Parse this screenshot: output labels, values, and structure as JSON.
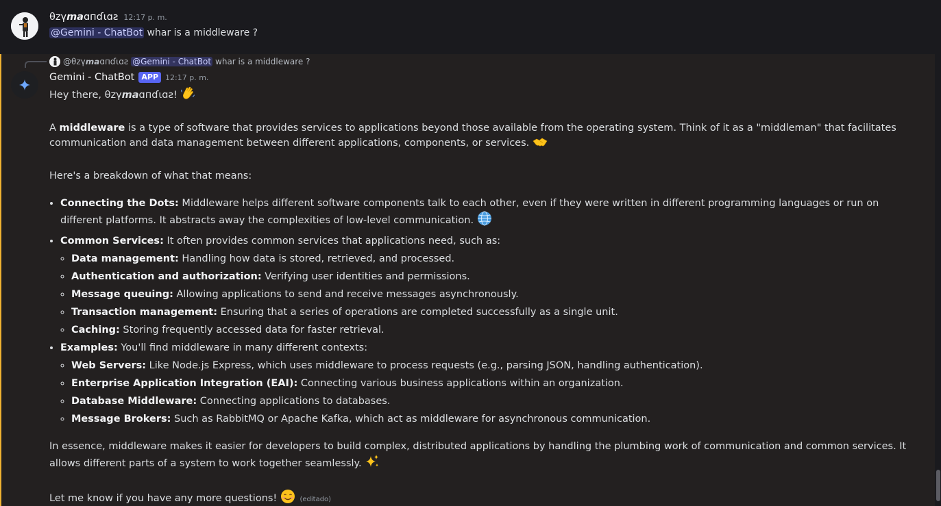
{
  "message1": {
    "username": "θzγ𝙢𝙖ɑпɗɩɑƨ",
    "timestamp": "12:17 p. m.",
    "mention": "@Gemini - ChatBot",
    "text": "whar is a middleware ?"
  },
  "reply": {
    "username": "@θzγ𝙢𝙖ɑпɗɩɑƨ",
    "mention": "@Gemini - ChatBot",
    "text": "whar is a middleware ?"
  },
  "message2": {
    "bot_name": "Gemini - ChatBot",
    "badge": "APP",
    "timestamp": "12:17 p. m.",
    "greeting": "Hey there, θzγ𝙢𝙖ɑпɗɩɑƨ!",
    "intro_a": "A ",
    "intro_bold": "middleware",
    "intro_rest": " is a type of software that provides services to applications beyond those available from the operating system. Think of it as a \"middleman\" that facilitates communication and data management between different applications, components, or services.",
    "breakdown": "Here's a breakdown of what that means:",
    "bullets": [
      {
        "title": "Connecting the Dots:",
        "text": " Middleware helps different software components talk to each other, even if they were written in different programming languages or run on different platforms. It abstracts away the complexities of low-level communication."
      },
      {
        "title": "Common Services:",
        "text": " It often provides common services that applications need, such as:",
        "sub": [
          {
            "title": "Data management:",
            "text": " Handling how data is stored, retrieved, and processed."
          },
          {
            "title": "Authentication and authorization:",
            "text": " Verifying user identities and permissions."
          },
          {
            "title": "Message queuing:",
            "text": " Allowing applications to send and receive messages asynchronously."
          },
          {
            "title": "Transaction management:",
            "text": " Ensuring that a series of operations are completed successfully as a single unit."
          },
          {
            "title": "Caching:",
            "text": " Storing frequently accessed data for faster retrieval."
          }
        ]
      },
      {
        "title": "Examples:",
        "text": " You'll find middleware in many different contexts:",
        "sub": [
          {
            "title": "Web Servers:",
            "text": " Like Node.js Express, which uses middleware to process requests (e.g., parsing JSON, handling authentication)."
          },
          {
            "title": "Enterprise Application Integration (EAI):",
            "text": " Connecting various business applications within an organization."
          },
          {
            "title": "Database Middleware:",
            "text": " Connecting applications to databases."
          },
          {
            "title": "Message Brokers:",
            "text": " Such as RabbitMQ or Apache Kafka, which act as middleware for asynchronous communication."
          }
        ]
      }
    ],
    "essence": "In essence, middleware makes it easier for developers to build complex, distributed applications by handling the plumbing work of communication and common services. It allows different parts of a system to work together seamlessly.",
    "closing": "Let me know if you have any more questions!",
    "edited": "(editado)"
  },
  "colors": {
    "background": "#1a1a1e",
    "highlight_bg": "#232020",
    "highlight_bar": "#f0b232",
    "mention_bg": "#3c4270",
    "badge": "#5865f2"
  },
  "icons": {
    "user_avatar": "user-avatar-icon",
    "bot_avatar": "gemini-sparkle-icon",
    "wave": "waving-hand-emoji",
    "handshake": "handshake-emoji",
    "globe": "globe-emoji",
    "sparkles": "sparkles-emoji",
    "smile": "smiling-face-emoji"
  }
}
